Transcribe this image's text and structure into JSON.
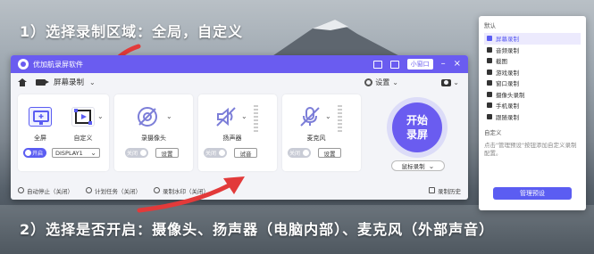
{
  "annotations": {
    "step1": "1）选择录制区域：全局，自定义",
    "step2": "2）选择是否开启：摄像头、扬声器（电脑内部）、麦克风（外部声音）"
  },
  "window": {
    "title": "优加航录屏软件",
    "mini_label": "小窗口",
    "mode_label": "屏幕录制",
    "settings_label": "设置"
  },
  "cards": {
    "screen": {
      "fullscreen_label": "全屏",
      "custom_label": "自定义",
      "toggle_label": "开启",
      "display_value": "DISPLAY1"
    },
    "camera": {
      "label": "录摄像头",
      "toggle_label": "关闭",
      "button_label": "设置"
    },
    "speaker": {
      "label": "扬声器",
      "toggle_label": "关闭",
      "button_label": "试音"
    },
    "mic": {
      "label": "麦克风",
      "toggle_label": "关闭",
      "button_label": "设置"
    }
  },
  "start_button": {
    "line1": "开始",
    "line2": "录屏"
  },
  "mouse_select": "鼠标录制",
  "bottom_bar": {
    "auto_stop": "自动停止（关闭）",
    "schedule": "计划任务（关闭）",
    "watermark": "录制水印（关闭）",
    "history": "录制历史"
  },
  "sidebar": {
    "header": "默认",
    "items": [
      {
        "label": "屏幕录制",
        "active": true
      },
      {
        "label": "音频录制",
        "active": false
      },
      {
        "label": "截图",
        "active": false
      },
      {
        "label": "游戏录制",
        "active": false
      },
      {
        "label": "窗口录制",
        "active": false
      },
      {
        "label": "摄像头录制",
        "active": false
      },
      {
        "label": "手机录制",
        "active": false
      },
      {
        "label": "跟随录制",
        "active": false
      }
    ],
    "custom_header": "自定义",
    "description": "点击\"管理预设\"按钮添加自定义录制配置。",
    "manage_button": "管理预设"
  },
  "colors": {
    "accent": "#6a5cf0",
    "toggle_on": "#5b5df2",
    "toggle_off": "#c9ccd6",
    "arrow": "#e23a3a"
  }
}
